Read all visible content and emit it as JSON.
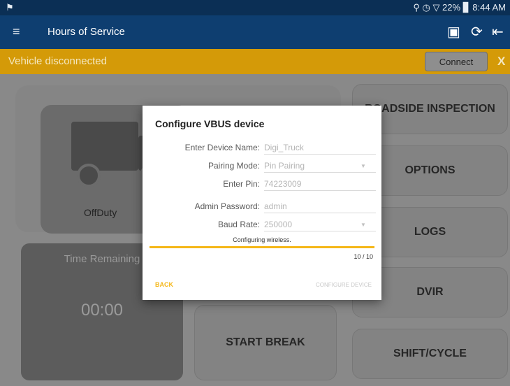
{
  "statusbar": {
    "notification_icon": "notification-icon",
    "right_text": "⚲ ◷ ▽ 22% ▊ 8:44 AM"
  },
  "appbar": {
    "menu_icon": "≡",
    "title": "Hours of Service",
    "icons": [
      "export-icon",
      "refresh-icon",
      "logout-icon"
    ]
  },
  "banner": {
    "message": "Vehicle disconnected",
    "connect_label": "Connect",
    "close_label": "X",
    "color": "#d49a08"
  },
  "duty": {
    "status": "OffDuty",
    "caret": "▾"
  },
  "time": {
    "label": "Time Remaining",
    "value": "00:00"
  },
  "buttons": {
    "roadside": "ROADSIDE INSPECTION",
    "options": "OPTIONS",
    "logs": "LOGS",
    "dvir": "DVIR",
    "shift": "SHIFT/CYCLE",
    "start_break": "START BREAK"
  },
  "dialog": {
    "title": "Configure VBUS device",
    "fields": [
      {
        "label": "Enter Device Name:",
        "value": "Digi_Truck"
      },
      {
        "label": "Pairing Mode:",
        "value": "Pin Pairing"
      },
      {
        "label": "Enter Pin:",
        "value": "74223009"
      },
      {
        "label": "Admin Password:",
        "value": "admin"
      },
      {
        "label": "Baud Rate:",
        "value": "250000"
      }
    ],
    "progress_text": "Configuring wireless.",
    "progress_fraction": 1.0,
    "progress_count": "10 / 10",
    "back_label": "BACK",
    "configure_label": "CONFIGURE DEVICE",
    "accent_color": "#f5b719"
  }
}
